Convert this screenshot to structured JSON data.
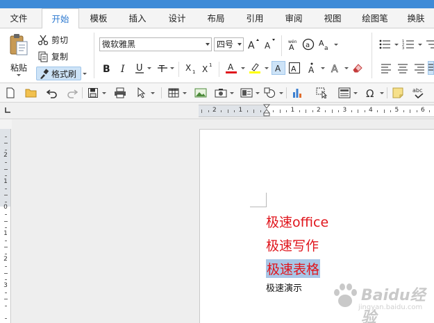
{
  "tabs": [
    "文件",
    "开始",
    "模板",
    "插入",
    "设计",
    "布局",
    "引用",
    "审阅",
    "视图",
    "绘图笔",
    "换肤"
  ],
  "active_tab": "开始",
  "clipboard": {
    "paste": "粘贴",
    "cut": "剪切",
    "copy": "复制",
    "format_painter": "格式刷"
  },
  "font": {
    "name": "微软雅黑",
    "size": "四号"
  },
  "colors": {
    "accent": "#3f8bd7",
    "active_tab_text": "#2b78d0",
    "doc_text_red": "#e0151c",
    "selection": "#a8c6e6",
    "font_color_bar": "#e0151c",
    "highlight_bar": "#ffff00"
  },
  "ruler": {
    "h_numbers": [
      "2",
      "1",
      "",
      "1",
      "2",
      "3",
      "4",
      "5",
      "6"
    ],
    "v_numbers": [
      "2",
      "1",
      "0",
      "1",
      "2",
      "3"
    ]
  },
  "document": {
    "lines": [
      "极速office",
      "极速写作",
      "极速表格",
      "极速演示"
    ]
  },
  "watermark": {
    "brand": "Baidu经验",
    "url": "jingyan.baidu.com"
  }
}
